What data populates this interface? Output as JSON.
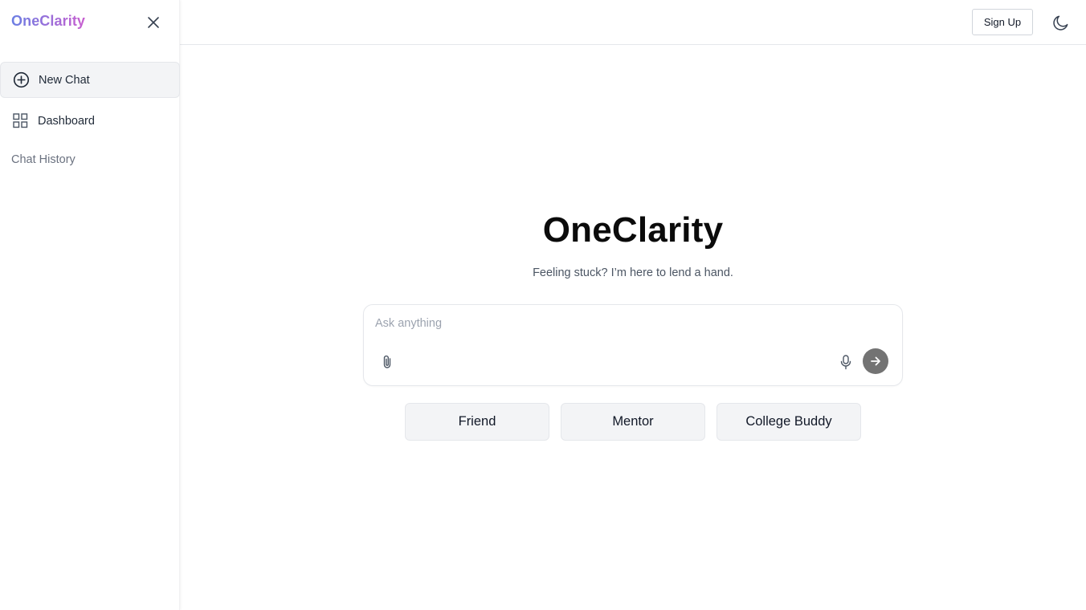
{
  "sidebar": {
    "brand": "OneClarity",
    "items": [
      {
        "label": "New Chat",
        "icon": "plus-circle-icon"
      },
      {
        "label": "Dashboard",
        "icon": "grid-icon"
      }
    ],
    "history_label": "Chat History"
  },
  "header": {
    "signup_label": "Sign Up",
    "theme_icon": "moon-icon"
  },
  "main": {
    "title": "OneClarity",
    "subtitle": "Feeling stuck? I’m here to lend a hand.",
    "composer": {
      "placeholder": "Ask anything",
      "value": ""
    },
    "personas": [
      "Friend",
      "Mentor",
      "College Buddy"
    ]
  },
  "colors": {
    "brand_gradient_start": "#6b7fe3",
    "brand_gradient_end": "#c85fd0",
    "send_button": "#737373",
    "persona_bg": "#f3f4f6"
  }
}
